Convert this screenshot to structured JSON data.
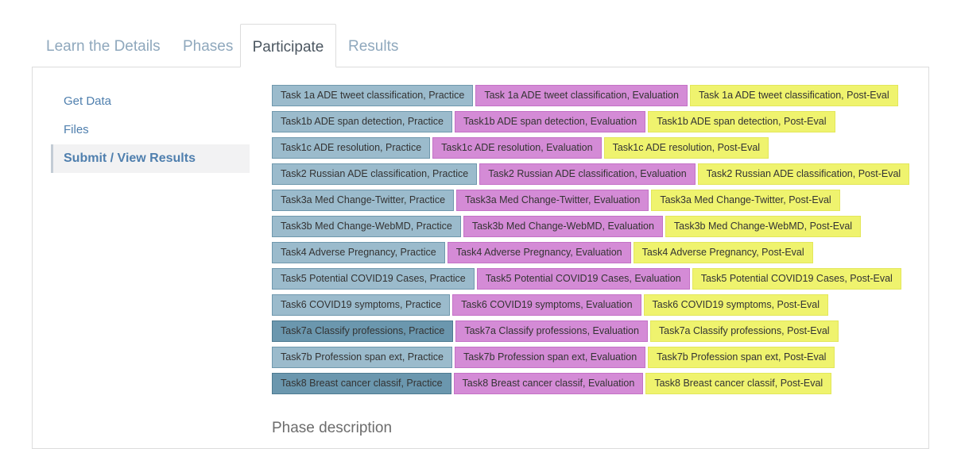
{
  "tabs": [
    {
      "label": "Learn the Details"
    },
    {
      "label": "Phases"
    },
    {
      "label": "Participate",
      "active": true
    },
    {
      "label": "Results"
    }
  ],
  "sidebar": {
    "items": [
      {
        "label": "Get Data"
      },
      {
        "label": "Files"
      },
      {
        "label": "Submit / View Results",
        "active": true
      }
    ]
  },
  "colors": {
    "practice": "#9bbbcc",
    "practice_selected": "#6b97ae",
    "evaluation": "#d48bd6",
    "posteval": "#eff36e",
    "link": "#4f7fae"
  },
  "phases": [
    {
      "practice": "Task 1a ADE tweet classification, Practice",
      "evaluation": "Task 1a ADE tweet classification, Evaluation",
      "posteval": "Task 1a ADE tweet classification, Post-Eval"
    },
    {
      "practice": "Task1b ADE span detection, Practice",
      "evaluation": "Task1b ADE span detection, Evaluation",
      "posteval": "Task1b ADE span detection, Post-Eval"
    },
    {
      "practice": "Task1c ADE resolution, Practice",
      "evaluation": "Task1c ADE resolution, Evaluation",
      "posteval": "Task1c ADE resolution, Post-Eval"
    },
    {
      "practice": "Task2 Russian ADE classification, Practice",
      "evaluation": "Task2 Russian ADE classification, Evaluation",
      "posteval": "Task2 Russian ADE classification, Post-Eval"
    },
    {
      "practice": "Task3a Med Change-Twitter, Practice",
      "evaluation": "Task3a Med Change-Twitter, Evaluation",
      "posteval": "Task3a Med Change-Twitter, Post-Eval"
    },
    {
      "practice": "Task3b Med Change-WebMD, Practice",
      "evaluation": "Task3b Med Change-WebMD, Evaluation",
      "posteval": "Task3b Med Change-WebMD, Post-Eval"
    },
    {
      "practice": "Task4 Adverse Pregnancy, Practice",
      "evaluation": "Task4 Adverse Pregnancy, Evaluation",
      "posteval": "Task4 Adverse Pregnancy, Post-Eval"
    },
    {
      "practice": "Task5 Potential COVID19 Cases, Practice",
      "evaluation": "Task5 Potential COVID19 Cases, Evaluation",
      "posteval": "Task5 Potential COVID19 Cases, Post-Eval"
    },
    {
      "practice": "Task6 COVID19 symptoms, Practice",
      "evaluation": "Task6 COVID19 symptoms, Evaluation",
      "posteval": "Task6 COVID19 symptoms, Post-Eval"
    },
    {
      "practice": "Task7a Classify professions, Practice",
      "evaluation": "Task7a Classify professions, Evaluation",
      "posteval": "Task7a Classify professions, Post-Eval",
      "practice_selected": true
    },
    {
      "practice": "Task7b Profession span ext, Practice",
      "evaluation": "Task7b Profession span ext, Evaluation",
      "posteval": "Task7b Profession span ext, Post-Eval"
    },
    {
      "practice": "Task8 Breast cancer classif, Practice",
      "evaluation": "Task8 Breast cancer classif, Evaluation",
      "posteval": "Task8 Breast cancer classif, Post-Eval",
      "practice_selected": true
    }
  ],
  "phase_description_heading": "Phase description"
}
